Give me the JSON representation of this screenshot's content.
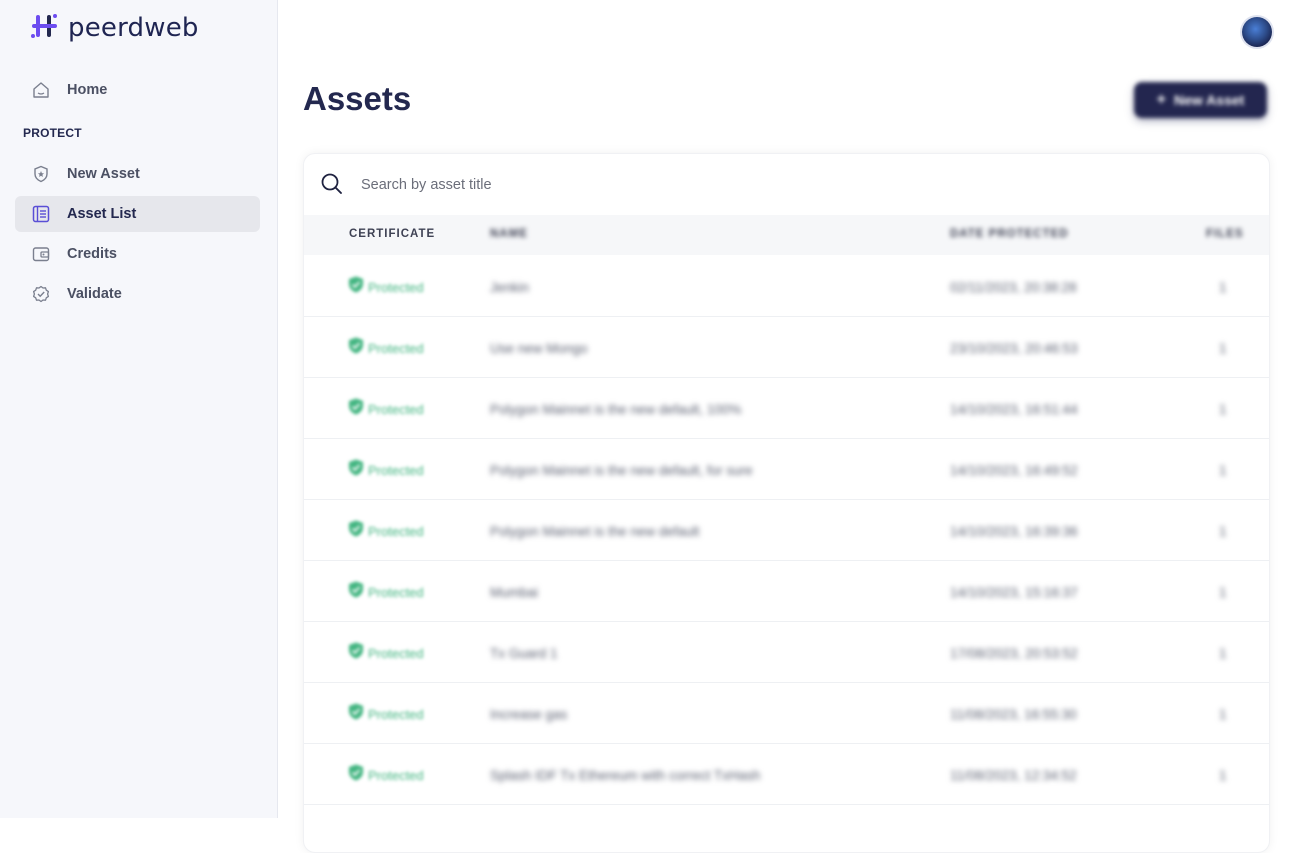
{
  "brand": {
    "name": "peerdweb"
  },
  "sidebar": {
    "home_label": "Home",
    "section_title": "PROTECT",
    "items": [
      {
        "label": "New Asset",
        "icon": "shield-icon"
      },
      {
        "label": "Asset List",
        "icon": "list-icon",
        "active": true
      },
      {
        "label": "Credits",
        "icon": "wallet-icon"
      },
      {
        "label": "Validate",
        "icon": "check-badge-icon"
      }
    ]
  },
  "header": {
    "title": "Assets",
    "new_button_label": "New Asset"
  },
  "search": {
    "placeholder": "Search by asset title"
  },
  "table": {
    "headers": [
      "CERTIFICATE",
      "NAME",
      "DATE PROTECTED",
      "FILES"
    ],
    "rows": [
      {
        "status": "Protected",
        "name": "Jenkin",
        "date": "02/11/2023, 20:38:28",
        "files": "1"
      },
      {
        "status": "Protected",
        "name": "Use new Mongo",
        "date": "23/10/2023, 20:46:53",
        "files": "1"
      },
      {
        "status": "Protected",
        "name": "Polygon Mainnet is the new default, 100%",
        "date": "14/10/2023, 16:51:44",
        "files": "1"
      },
      {
        "status": "Protected",
        "name": "Polygon Mainnet is the new default, for sure",
        "date": "14/10/2023, 16:49:52",
        "files": "1"
      },
      {
        "status": "Protected",
        "name": "Polygon Mainnet is the new default",
        "date": "14/10/2023, 16:39:36",
        "files": "1"
      },
      {
        "status": "Protected",
        "name": "Mumbai",
        "date": "14/10/2023, 15:16:37",
        "files": "1"
      },
      {
        "status": "Protected",
        "name": "Tx Guard 1",
        "date": "17/08/2023, 20:53:52",
        "files": "1"
      },
      {
        "status": "Protected",
        "name": "Increase gas",
        "date": "11/08/2023, 16:55:30",
        "files": "1"
      },
      {
        "status": "Protected",
        "name": "Splash IDF Tx Ethereum with correct TxHash",
        "date": "11/08/2023, 12:34:52",
        "files": "1"
      }
    ]
  },
  "colors": {
    "primary": "#23264f",
    "protected": "#43b581",
    "sidebar_bg": "#f6f7fb"
  }
}
